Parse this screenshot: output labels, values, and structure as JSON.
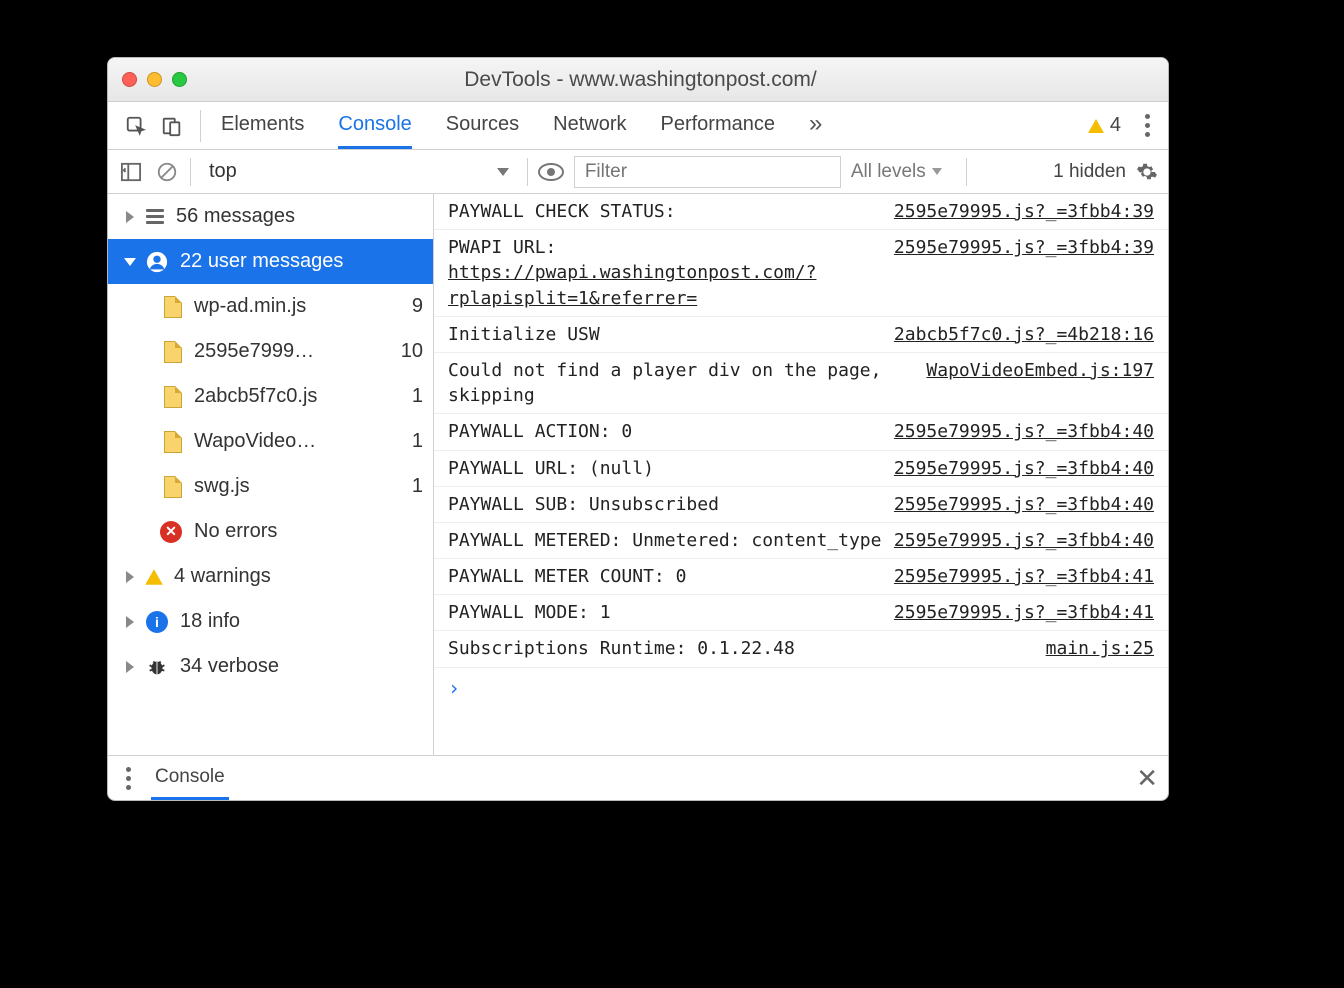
{
  "window": {
    "title": "DevTools - www.washingtonpost.com/"
  },
  "tabs": [
    "Elements",
    "Console",
    "Sources",
    "Network",
    "Performance"
  ],
  "activeTab": "Console",
  "more_tabs_icon": "»",
  "warnings_badge": "4",
  "filterbar": {
    "context": "top",
    "filter_placeholder": "Filter",
    "levels": "All levels",
    "hidden": "1 hidden"
  },
  "sidebar": {
    "messages": {
      "count": 56,
      "label": "messages"
    },
    "user": {
      "count": 22,
      "label": "user messages"
    },
    "files": [
      {
        "name": "wp-ad.min.js",
        "count": 9
      },
      {
        "name": "2595e7999…",
        "count": 10
      },
      {
        "name": "2abcb5f7c0.js",
        "count": 1
      },
      {
        "name": "WapoVideo…",
        "count": 1
      },
      {
        "name": "swg.js",
        "count": 1
      }
    ],
    "errors": {
      "count": "No",
      "label": "errors"
    },
    "warnings": {
      "count": 4,
      "label": "warnings"
    },
    "info": {
      "count": 18,
      "label": "info"
    },
    "verbose": {
      "count": 34,
      "label": "verbose"
    }
  },
  "logs": [
    {
      "msg": "PAYWALL CHECK STATUS:",
      "src": "2595e79995.js?_=3fbb4:39"
    },
    {
      "msg": "PWAPI URL: ",
      "link": "https://pwapi.washingtonpost.com/?rplapisplit=1&referrer=",
      "src": "2595e79995.js?_=3fbb4:39"
    },
    {
      "msg": "Initialize USW",
      "src": "2abcb5f7c0.js?_=4b218:16"
    },
    {
      "msg": "Could not find a player div on the page, skipping",
      "src": "WapoVideoEmbed.js:197"
    },
    {
      "msg": "PAYWALL ACTION: 0",
      "src": "2595e79995.js?_=3fbb4:40"
    },
    {
      "msg": "PAYWALL URL: (null)",
      "src": "2595e79995.js?_=3fbb4:40"
    },
    {
      "msg": "PAYWALL SUB: Unsubscribed",
      "src": "2595e79995.js?_=3fbb4:40"
    },
    {
      "msg": "PAYWALL METERED: Unmetered: content_type",
      "src": "2595e79995.js?_=3fbb4:40"
    },
    {
      "msg": "PAYWALL METER COUNT: 0",
      "src": "2595e79995.js?_=3fbb4:41"
    },
    {
      "msg": "PAYWALL MODE: 1",
      "src": "2595e79995.js?_=3fbb4:41"
    },
    {
      "msg": "Subscriptions Runtime: 0.1.22.48",
      "src": "main.js:25"
    }
  ],
  "drawer": {
    "label": "Console"
  }
}
